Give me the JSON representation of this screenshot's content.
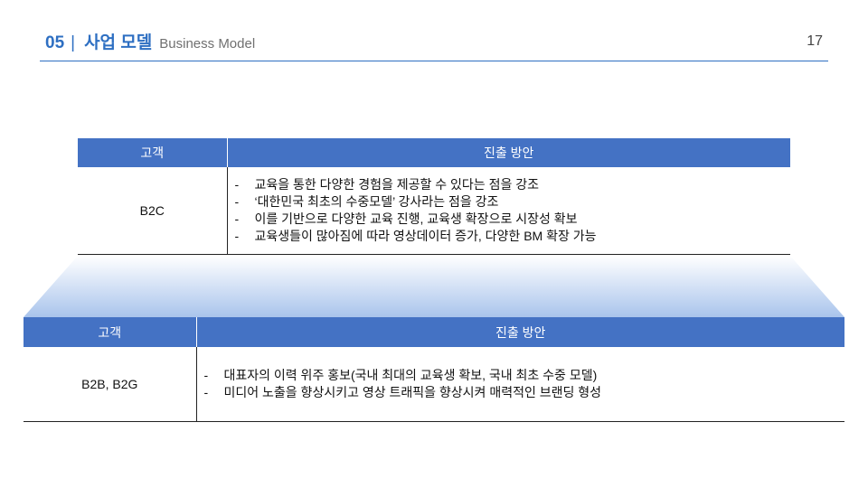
{
  "header": {
    "section_number": "05",
    "section_divider": "|",
    "section_title": "사업 모델",
    "section_subtitle": "Business Model",
    "page_number": "17"
  },
  "colors": {
    "accent": "#2e6fc2",
    "table_header": "#4472c4",
    "gradient_top": "#ffffff",
    "gradient_bottom": "#a9c4ec"
  },
  "table_b2c": {
    "headers": [
      "고객",
      "진출 방안"
    ],
    "customer": "B2C",
    "points": [
      "교육을 통한 다양한 경험을 제공할 수 있다는 점을 강조",
      "‘대한민국 최초의 수중모델’ 강사라는 점을 강조",
      "이를 기반으로 다양한 교육 진행, 교육생 확장으로 시장성 확보",
      "교육생들이 많아짐에 따라 영상데이터 증가, 다양한 BM 확장 가능"
    ]
  },
  "table_b2b": {
    "headers": [
      "고객",
      "진출 방안"
    ],
    "customer": "B2B, B2G",
    "points": [
      "대표자의 이력 위주 홍보(국내 최대의 교육생 확보, 국내 최초 수중 모델)",
      "미디어 노출을 향상시키고 영상 트래픽을 향상시켜 매력적인 브랜딩 형성"
    ]
  },
  "bullet_marker": "-"
}
